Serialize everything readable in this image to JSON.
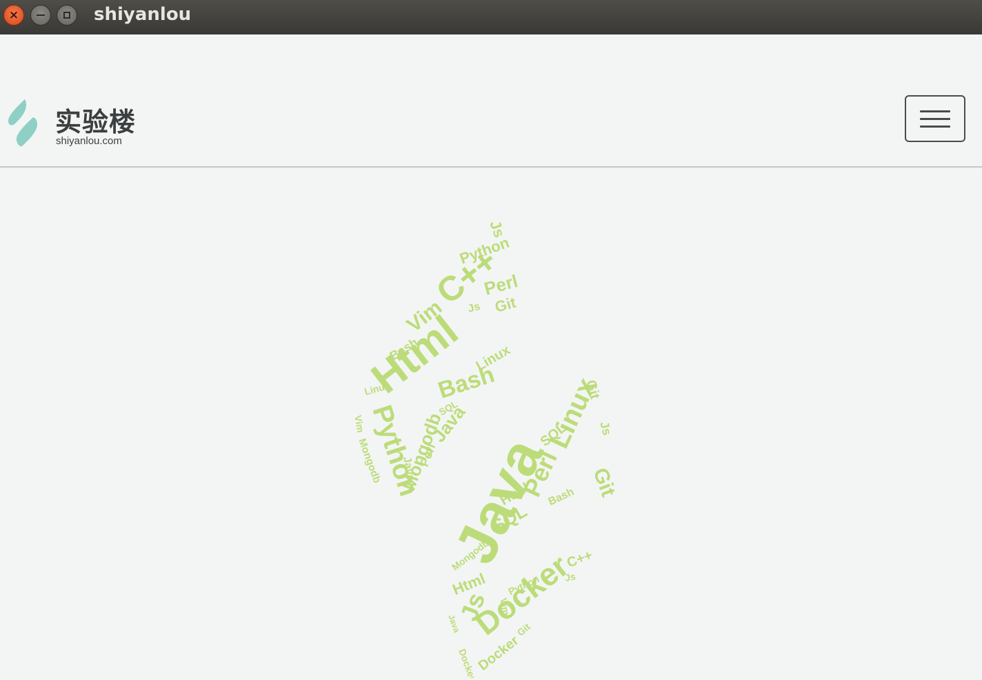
{
  "window": {
    "title": "shiyanlou",
    "close_glyph": "×"
  },
  "brand": {
    "name_cn": "实验楼",
    "url": "shiyanlou.com",
    "logo_color": "#8fd0c6"
  },
  "navbar": {
    "menu_icon": "hamburger-menu-icon"
  },
  "wordcloud": {
    "color": "#bcdc7a",
    "words": [
      "Html",
      "C++",
      "Python",
      "Bash",
      "Vim",
      "Perl",
      "Git",
      "Js",
      "Linux",
      "Java",
      "Mongodb",
      "SQL",
      "Docker"
    ]
  }
}
